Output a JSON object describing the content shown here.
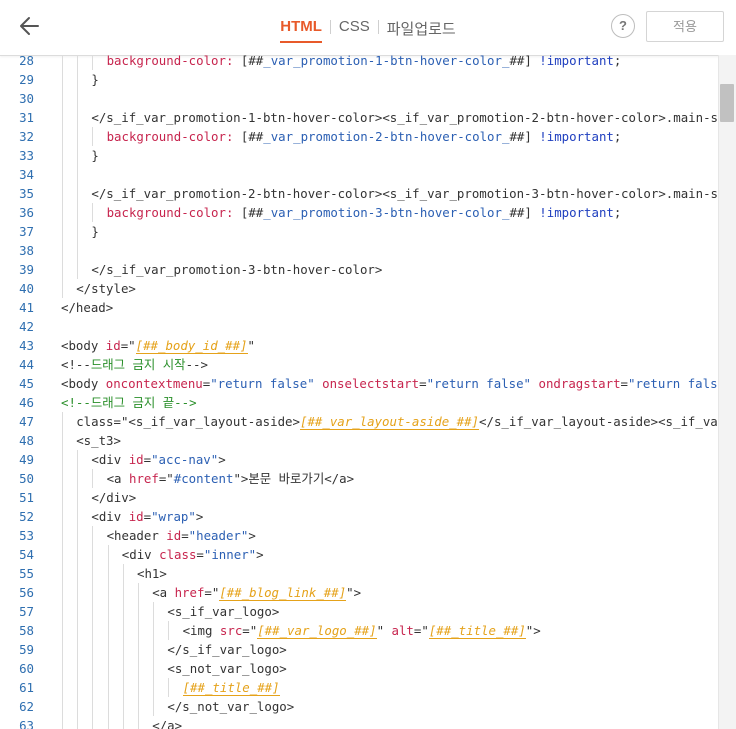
{
  "header": {
    "tabs": [
      {
        "label": "HTML",
        "active": true
      },
      {
        "label": "CSS",
        "active": false
      },
      {
        "label": "파일업로드",
        "active": false
      }
    ],
    "help_label": "?",
    "apply_label": "적용"
  },
  "colors": {
    "accent": "#e85a2a",
    "line_number": "#2f6fb0",
    "tag": "#333333",
    "attribute": "#c7254e",
    "string": "#2b5fb3",
    "variable": "#e5a21a",
    "comment": "#2a8f2a",
    "important_keyword": "#1f3fbf"
  },
  "editor": {
    "lines": [
      {
        "n": "28",
        "indent": 3,
        "segs": [
          [
            "at",
            "background-color: "
          ],
          [
            "tg",
            "[##"
          ],
          [
            "st",
            "_var_promotion-1-btn-hover-color_"
          ],
          [
            "tg",
            "##] "
          ],
          [
            "kw",
            "!important"
          ],
          [
            "tg",
            ";"
          ]
        ]
      },
      {
        "n": "29",
        "indent": 2,
        "segs": [
          [
            "tg",
            "}"
          ]
        ]
      },
      {
        "n": "30",
        "indent": 0,
        "segs": []
      },
      {
        "n": "31",
        "indent": 2,
        "segs": [
          [
            "tg",
            "</s_if_var_promotion-1-btn-hover-color><s_if_var_promotion-2-btn-hover-color>.main-s"
          ]
        ]
      },
      {
        "n": "32",
        "indent": 3,
        "segs": [
          [
            "at",
            "background-color: "
          ],
          [
            "tg",
            "[##"
          ],
          [
            "st",
            "_var_promotion-2-btn-hover-color_"
          ],
          [
            "tg",
            "##] "
          ],
          [
            "kw",
            "!important"
          ],
          [
            "tg",
            ";"
          ]
        ]
      },
      {
        "n": "33",
        "indent": 2,
        "segs": [
          [
            "tg",
            "}"
          ]
        ]
      },
      {
        "n": "34",
        "indent": 0,
        "segs": []
      },
      {
        "n": "35",
        "indent": 2,
        "segs": [
          [
            "tg",
            "</s_if_var_promotion-2-btn-hover-color><s_if_var_promotion-3-btn-hover-color>.main-s"
          ]
        ]
      },
      {
        "n": "36",
        "indent": 3,
        "segs": [
          [
            "at",
            "background-color: "
          ],
          [
            "tg",
            "[##"
          ],
          [
            "st",
            "_var_promotion-3-btn-hover-color_"
          ],
          [
            "tg",
            "##] "
          ],
          [
            "kw",
            "!important"
          ],
          [
            "tg",
            ";"
          ]
        ]
      },
      {
        "n": "37",
        "indent": 2,
        "segs": [
          [
            "tg",
            "}"
          ]
        ]
      },
      {
        "n": "38",
        "indent": 0,
        "segs": []
      },
      {
        "n": "39",
        "indent": 2,
        "segs": [
          [
            "tg",
            "</s_if_var_promotion-3-btn-hover-color>"
          ]
        ]
      },
      {
        "n": "40",
        "indent": 1,
        "segs": [
          [
            "tg",
            "</style>"
          ]
        ]
      },
      {
        "n": "41",
        "indent": 0,
        "segs": [
          [
            "tg",
            "</head>"
          ]
        ]
      },
      {
        "n": "42",
        "indent": 0,
        "segs": []
      },
      {
        "n": "43",
        "indent": 0,
        "segs": [
          [
            "tg",
            "<body "
          ],
          [
            "at",
            "id"
          ],
          [
            "tg",
            "=\""
          ],
          [
            "vr",
            "[##_body_id_##]"
          ],
          [
            "tg",
            "\""
          ]
        ]
      },
      {
        "n": "44",
        "indent": 0,
        "segs": [
          [
            "tg",
            "<!--"
          ],
          [
            "cm",
            "드래그 금지 시작"
          ],
          [
            "tg",
            "-->"
          ]
        ]
      },
      {
        "n": "45",
        "indent": 0,
        "segs": [
          [
            "tg",
            "<body "
          ],
          [
            "at",
            "oncontextmenu"
          ],
          [
            "tg",
            "="
          ],
          [
            "st",
            "\"return false\""
          ],
          [
            "tg",
            " "
          ],
          [
            "at",
            "onselectstart"
          ],
          [
            "tg",
            "="
          ],
          [
            "st",
            "\"return false\""
          ],
          [
            "tg",
            " "
          ],
          [
            "at",
            "ondragstart"
          ],
          [
            "tg",
            "="
          ],
          [
            "st",
            "\"return fals"
          ]
        ]
      },
      {
        "n": "46",
        "indent": 0,
        "segs": [
          [
            "cm",
            "<!--드래그 금지 끝-->"
          ]
        ]
      },
      {
        "n": "47",
        "indent": 1,
        "segs": [
          [
            "tg",
            "class=\"<s_if_var_layout-aside>"
          ],
          [
            "vr",
            "[##_var_layout-aside_##]"
          ],
          [
            "tg",
            "</s_if_var_layout-aside><s_if_va"
          ]
        ]
      },
      {
        "n": "48",
        "indent": 1,
        "segs": [
          [
            "tg",
            "<s_t3>"
          ]
        ]
      },
      {
        "n": "49",
        "indent": 2,
        "segs": [
          [
            "tg",
            "<div "
          ],
          [
            "at",
            "id"
          ],
          [
            "tg",
            "="
          ],
          [
            "st",
            "\"acc-nav\""
          ],
          [
            "tg",
            ">"
          ]
        ]
      },
      {
        "n": "50",
        "indent": 3,
        "segs": [
          [
            "tg",
            "<a "
          ],
          [
            "at",
            "href"
          ],
          [
            "tg",
            "=\""
          ],
          [
            "st",
            "#content"
          ],
          [
            "tg",
            "\">본문 바로가기</a>"
          ]
        ]
      },
      {
        "n": "51",
        "indent": 2,
        "segs": [
          [
            "tg",
            "</div>"
          ]
        ]
      },
      {
        "n": "52",
        "indent": 2,
        "segs": [
          [
            "tg",
            "<div "
          ],
          [
            "at",
            "id"
          ],
          [
            "tg",
            "="
          ],
          [
            "st",
            "\"wrap\""
          ],
          [
            "tg",
            ">"
          ]
        ]
      },
      {
        "n": "53",
        "indent": 3,
        "segs": [
          [
            "tg",
            "<header "
          ],
          [
            "at",
            "id"
          ],
          [
            "tg",
            "="
          ],
          [
            "st",
            "\"header\""
          ],
          [
            "tg",
            ">"
          ]
        ]
      },
      {
        "n": "54",
        "indent": 4,
        "segs": [
          [
            "tg",
            "<div "
          ],
          [
            "at",
            "class"
          ],
          [
            "tg",
            "="
          ],
          [
            "st",
            "\"inner\""
          ],
          [
            "tg",
            ">"
          ]
        ]
      },
      {
        "n": "55",
        "indent": 5,
        "segs": [
          [
            "tg",
            "<h1>"
          ]
        ]
      },
      {
        "n": "56",
        "indent": 6,
        "segs": [
          [
            "tg",
            "<a "
          ],
          [
            "at",
            "href"
          ],
          [
            "tg",
            "=\""
          ],
          [
            "vr",
            "[##_blog_link_##]"
          ],
          [
            "tg",
            "\">"
          ]
        ]
      },
      {
        "n": "57",
        "indent": 7,
        "segs": [
          [
            "tg",
            "<s_if_var_logo>"
          ]
        ]
      },
      {
        "n": "58",
        "indent": 8,
        "segs": [
          [
            "tg",
            "<img "
          ],
          [
            "at",
            "src"
          ],
          [
            "tg",
            "=\""
          ],
          [
            "vr",
            "[##_var_logo_##]"
          ],
          [
            "tg",
            "\" "
          ],
          [
            "at",
            "alt"
          ],
          [
            "tg",
            "=\""
          ],
          [
            "vr",
            "[##_title_##]"
          ],
          [
            "tg",
            "\">"
          ]
        ]
      },
      {
        "n": "59",
        "indent": 7,
        "segs": [
          [
            "tg",
            "</s_if_var_logo>"
          ]
        ]
      },
      {
        "n": "60",
        "indent": 7,
        "segs": [
          [
            "tg",
            "<s_not_var_logo>"
          ]
        ]
      },
      {
        "n": "61",
        "indent": 8,
        "segs": [
          [
            "vr",
            "[##_title_##]"
          ]
        ]
      },
      {
        "n": "62",
        "indent": 7,
        "segs": [
          [
            "tg",
            "</s_not_var_logo>"
          ]
        ]
      },
      {
        "n": "63",
        "indent": 6,
        "segs": [
          [
            "tg",
            "</a>"
          ]
        ]
      }
    ]
  }
}
